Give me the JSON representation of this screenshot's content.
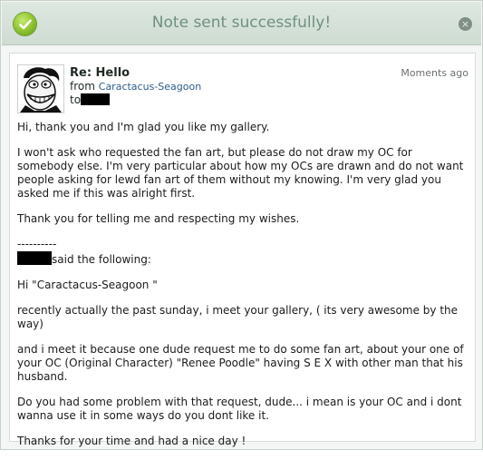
{
  "dialog": {
    "title": "Note sent successfully!",
    "close_glyph": "×",
    "icons": {
      "status": "check-circle-icon",
      "close": "close-circle-icon"
    }
  },
  "note": {
    "subject": "Re: Hello",
    "from_label": "from",
    "from_user": "Caractacus-Seagoon",
    "to_label": "to",
    "timestamp": "Moments ago",
    "reply_paragraphs": [
      "Hi, thank you and I'm glad you like my gallery.",
      "I won't ask who requested the fan art, but please do not draw my OC for somebody else. I'm very particular about how my OCs are drawn and do not want people asking for lewd fan art of them without my knowing. I'm very glad you asked me if this was alright first.",
      "Thank you for telling me and respecting my wishes."
    ],
    "separator": "----------",
    "said_following": "said the following:",
    "quoted_paragraphs": [
      "Hi \"Caractacus-Seagoon \"",
      "recently actually the past sunday, i meet your gallery, ( its very awesome by the way)",
      "and i meet it because one dude request me to do some fan art, about your one of your OC (Original Character) \"Renee Poodle\" having S E X with other man that his husband.",
      "Do you had some problem with that request, dude... i mean is your OC and i dont wanna use it in some ways do you dont like it.",
      "Thanks for your time and had a nice day !"
    ]
  }
}
